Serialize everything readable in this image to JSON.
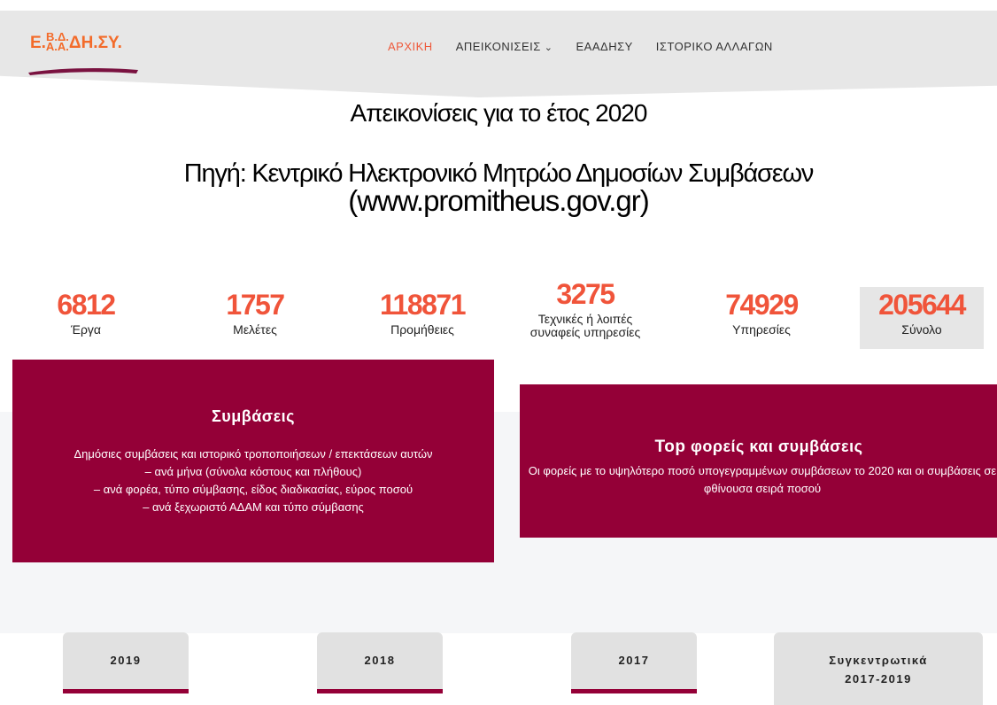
{
  "logo": {
    "text_main": "Ε.",
    "text_sup": "Β.Δ.",
    "text_sub": "Α.Α.",
    "text_tail": "ΔΗ.ΣΥ."
  },
  "nav": {
    "items": [
      {
        "label": "ΑΡΧΙΚΗ",
        "active": true
      },
      {
        "label": "ΑΠΕΙΚΟΝΙΣΕΙΣ",
        "dropdown": true
      },
      {
        "label": "ΕΑΑΔΗΣΥ"
      },
      {
        "label": "ΙΣΤΟΡΙΚΟ ΑΛΛΑΓΩΝ"
      }
    ],
    "caret": "⌄"
  },
  "page": {
    "title": "Απεικονίσεις για το έτος 2020",
    "source_line1": "Πηγή: Κεντρικό Ηλεκτρονικό Μητρώο Δημοσίων Συμβάσεων",
    "source_line2": "(www.promitheus.gov.gr)"
  },
  "stats": [
    {
      "value": "6812",
      "label": "Έργα"
    },
    {
      "value": "1757",
      "label": "Μελέτες"
    },
    {
      "value": "118871",
      "label": "Προμήθειες"
    },
    {
      "value": "3275",
      "label": "Τεχνικές ή λοιπές συναφείς υπηρεσίες"
    },
    {
      "value": "74929",
      "label": "Υπηρεσίες"
    },
    {
      "value": "205644",
      "label": "Σύνολο"
    }
  ],
  "cards": {
    "contracts": {
      "title": "Συμβάσεις",
      "lines": [
        "Δημόσιες συμβάσεις και ιστορικό τροποποιήσεων / επεκτάσεων αυτών",
        "– ανά μήνα (σύνολα κόστους και πλήθους)",
        "– ανά φορέα, τύπο σύμβασης, είδος διαδικασίας, εύρος ποσού",
        "– ανά ξεχωριστό ΑΔΑΜ και τύπο σύμβασης"
      ]
    },
    "top": {
      "title_bold": "Top",
      "title_rest": " φορείς και συμβάσεις",
      "desc": "Οι φορείς με το υψηλότερο ποσό υπογεγραμμένων συμβάσεων το 2020 και οι συμβάσεις σε φθίνουσα σειρά ποσού"
    }
  },
  "year_buttons": {
    "y2019": "2019",
    "y2018": "2018",
    "y2017": "2017",
    "summary_l1": "Συγκεντρωτικά",
    "summary_l2": "2017-2019"
  },
  "colors": {
    "accent": "#f0543a",
    "brand": "#940037",
    "header_gray": "#e7e7e7"
  }
}
